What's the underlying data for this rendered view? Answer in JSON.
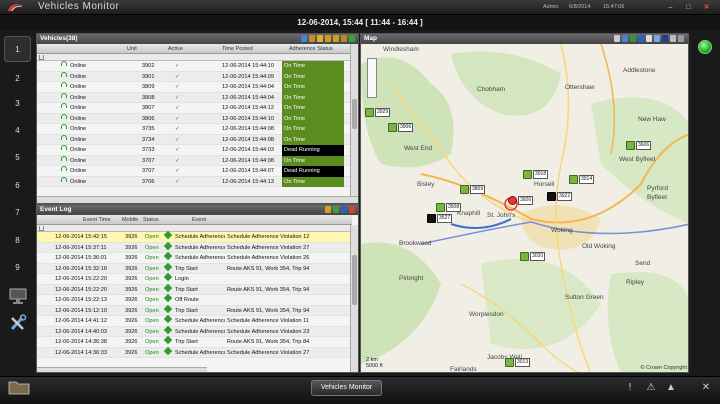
{
  "titlebar": {
    "app_title": "Vehicles Monitor",
    "user": "Admin",
    "date": "6/8/2014",
    "time": "15:47:06"
  },
  "datebar": {
    "text": "12-06-2014, 15:44   [ 11:44 - 16:44 ]"
  },
  "leftnav": {
    "items": [
      "1",
      "2",
      "3",
      "4",
      "5",
      "6",
      "7",
      "8",
      "9"
    ]
  },
  "vehicles": {
    "title": "Vehicles(38)",
    "columns": {
      "unit": "Unit",
      "active": "Active",
      "time_posted": "Time Posted",
      "adherence": "Adherence Status"
    },
    "rows": [
      {
        "status": "Online",
        "unit": "3902",
        "active": "✓",
        "time": "12-06-2014 15:44:10",
        "adherence": "On Time"
      },
      {
        "status": "Online",
        "unit": "3901",
        "active": "✓",
        "time": "12-06-2014 15:44:09",
        "adherence": "On Time"
      },
      {
        "status": "Online",
        "unit": "3809",
        "active": "✓",
        "time": "12-06-2014 15:44:04",
        "adherence": "On Time"
      },
      {
        "status": "Online",
        "unit": "3808",
        "active": "✓",
        "time": "12-06-2014 15:44:04",
        "adherence": "On Time"
      },
      {
        "status": "Online",
        "unit": "3807",
        "active": "✓",
        "time": "12-06-2014 15:44:12",
        "adherence": "On Time"
      },
      {
        "status": "Online",
        "unit": "3806",
        "active": "✓",
        "time": "12-06-2014 15:44:10",
        "adherence": "On Time"
      },
      {
        "status": "Online",
        "unit": "3735",
        "active": "✓",
        "time": "12-06-2014 15:44:08",
        "adherence": "On Time"
      },
      {
        "status": "Online",
        "unit": "3734",
        "active": "✓",
        "time": "12-06-2014 15:44:08",
        "adherence": "On Time"
      },
      {
        "status": "Online",
        "unit": "3733",
        "active": "✓",
        "time": "12-06-2014 15:44:03",
        "adherence": "Dead Running"
      },
      {
        "status": "Online",
        "unit": "3707",
        "active": "✓",
        "time": "12-06-2014 15:44:08",
        "adherence": "On Time"
      },
      {
        "status": "Online",
        "unit": "3707",
        "active": "✓",
        "time": "12-06-2014 15:44:07",
        "adherence": "Dead Running"
      },
      {
        "status": "Online",
        "unit": "3706",
        "active": "✓",
        "time": "12-06-2014 15:44:13",
        "adherence": "On Time"
      }
    ]
  },
  "eventlog": {
    "title": "Event Log",
    "columns": {
      "event_time": "Event Time",
      "mobile": "Mobile",
      "status": "Status",
      "event": "Event"
    },
    "rows": [
      {
        "time": "12-06-2014 15:42:15",
        "mobile": "3926",
        "status": "Open",
        "event": "Schedule Adherence",
        "detail": "Schedule Adherence Violation 12"
      },
      {
        "time": "12-06-2014 15:37:11",
        "mobile": "3926",
        "status": "Open",
        "event": "Schedule Adherence",
        "detail": "Schedule Adherence Violation 27"
      },
      {
        "time": "12-06-2014 15:36:01",
        "mobile": "3926",
        "status": "Open",
        "event": "Schedule Adherence",
        "detail": "Schedule Adherence Violation 26"
      },
      {
        "time": "12-06-2014 15:32:18",
        "mobile": "3926",
        "status": "Open",
        "event": "Trip Start",
        "detail": "Route AKS 91, Work 354, Trip 94"
      },
      {
        "time": "12-06-2014 15:22:20",
        "mobile": "3926",
        "status": "Open",
        "event": "Login",
        "detail": ""
      },
      {
        "time": "12-06-2014 15:22:20",
        "mobile": "3926",
        "status": "Open",
        "event": "Trip Start",
        "detail": "Route AKS 91, Work 354, Trip 94"
      },
      {
        "time": "12-06-2014 15:22:13",
        "mobile": "3926",
        "status": "Open",
        "event": "Off Route",
        "detail": ""
      },
      {
        "time": "12-06-2014 15:12:10",
        "mobile": "3926",
        "status": "Open",
        "event": "Trip Start",
        "detail": "Route AKS 91, Work 354, Trip 94"
      },
      {
        "time": "12-06-2014 14:41:12",
        "mobile": "3926",
        "status": "Open",
        "event": "Schedule Adherence",
        "detail": "Schedule Adherence Violation 11"
      },
      {
        "time": "12-06-2014 14:40:03",
        "mobile": "3926",
        "status": "Open",
        "event": "Schedule Adherence",
        "detail": "Schedule Adherence Violation 23"
      },
      {
        "time": "12-06-2014 14:36:38",
        "mobile": "3926",
        "status": "Open",
        "event": "Trip Start",
        "detail": "Route AKS 91, Work 354, Trip 84"
      },
      {
        "time": "12-06-2014 14:36:33",
        "mobile": "3926",
        "status": "Open",
        "event": "Schedule Adherence",
        "detail": "Schedule Adherence Violation 27"
      }
    ]
  },
  "map": {
    "title": "Map",
    "scale_km": "2 km",
    "scale_ft": "5000 ft",
    "copyright": "© Crown Copyright",
    "places": [
      "Windlesham",
      "Chobham",
      "Ottershaw",
      "Addlestone",
      "New Haw",
      "West Byfleet",
      "Byfleet",
      "Pyrford",
      "West End",
      "Bisley",
      "Horsell",
      "St. John's",
      "Knaphill",
      "Woking",
      "Brookwood",
      "Old Woking",
      "Send",
      "Ripley",
      "Pirbright",
      "Sutton Green",
      "Worplesdon",
      "Fairlands",
      "Jacobs Well"
    ],
    "vehicles": [
      "3929",
      "3906",
      "3606",
      "3018",
      "3014",
      "3809",
      "3922",
      "3926",
      "3508",
      "3527",
      "3020",
      "3013"
    ]
  },
  "taskbar": {
    "button": "Vehicles Monitor"
  }
}
